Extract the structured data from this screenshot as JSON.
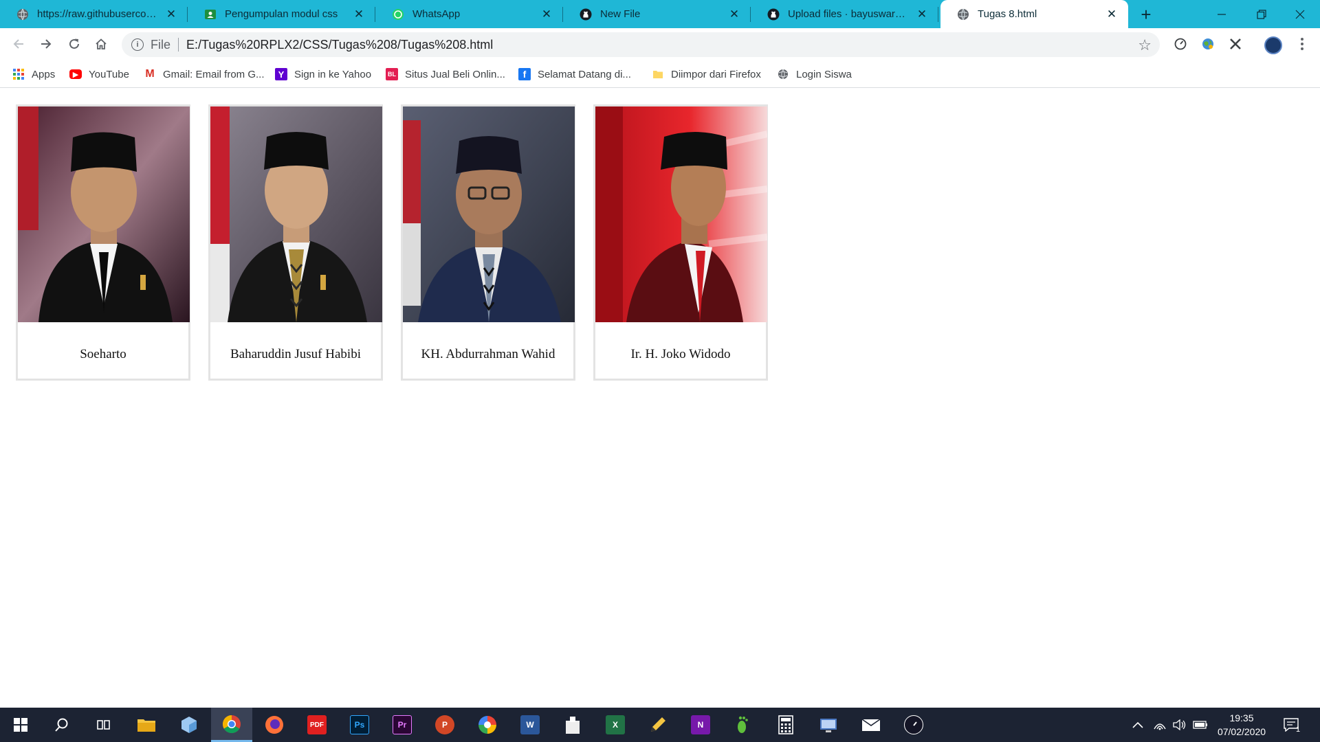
{
  "browser": {
    "tabs": [
      {
        "title": "https://raw.githubusercontent.com",
        "icon": "globe-icon",
        "active": false
      },
      {
        "title": "Pengumpulan modul css",
        "icon": "google-classroom-icon",
        "active": false
      },
      {
        "title": "WhatsApp",
        "icon": "whatsapp-icon",
        "active": false
      },
      {
        "title": "New File",
        "icon": "github-icon",
        "active": false
      },
      {
        "title": "Upload files · bayuswara/CSS",
        "icon": "github-icon",
        "active": false
      },
      {
        "title": "Tugas 8.html",
        "icon": "globe-icon",
        "active": true
      }
    ],
    "new_tab_label": "+",
    "address": {
      "scheme": "File",
      "url": "E:/Tugas%20RPLX2/CSS/Tugas%208/Tugas%208.html"
    },
    "bookmarks": [
      {
        "label": "Apps",
        "icon": "apps-grid-icon"
      },
      {
        "label": "YouTube",
        "icon": "youtube-icon"
      },
      {
        "label": "Gmail: Email from G...",
        "icon": "gmail-icon"
      },
      {
        "label": "Sign in ke Yahoo",
        "icon": "yahoo-icon"
      },
      {
        "label": "Situs Jual Beli Onlin...",
        "icon": "bukalapak-icon"
      },
      {
        "label": "Selamat Datang di...",
        "icon": "facebook-icon"
      },
      {
        "label": "Diimpor dari Firefox",
        "icon": "folder-icon"
      },
      {
        "label": "Login Siswa",
        "icon": "globe-icon"
      }
    ]
  },
  "page": {
    "cards": [
      {
        "name": "Soeharto",
        "photo_bg": "#5b2f3a"
      },
      {
        "name": "Baharuddin Jusuf Habibi",
        "photo_bg": "#6a6570"
      },
      {
        "name": "KH. Abdurrahman Wahid",
        "photo_bg": "#454b5e"
      },
      {
        "name": "Ir. H. Joko Widodo",
        "photo_bg": "#c8191f"
      }
    ]
  },
  "taskbar": {
    "time": "19:35",
    "date": "07/02/2020",
    "notification_count": "1"
  },
  "colors": {
    "tabstrip": "#1fb7d6",
    "taskbar": "#1c2333"
  }
}
